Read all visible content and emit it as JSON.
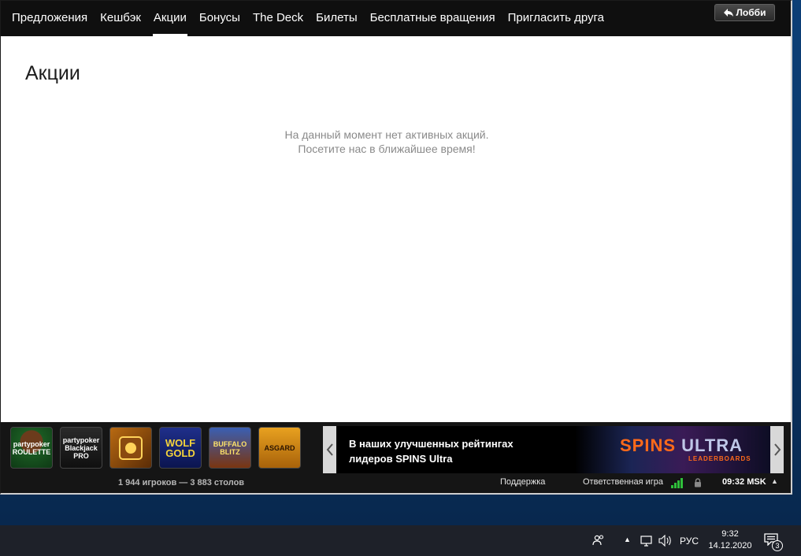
{
  "nav": {
    "tabs": [
      {
        "label": "Предложения"
      },
      {
        "label": "Кешбэк"
      },
      {
        "label": "Акции"
      },
      {
        "label": "Бонусы"
      },
      {
        "label": "The Deck"
      },
      {
        "label": "Билеты"
      },
      {
        "label": "Бесплатные вращения"
      },
      {
        "label": "Пригласить друга"
      }
    ],
    "active_tab": "Акции",
    "lobby_label": "Лобби"
  },
  "main": {
    "title": "Акции",
    "empty_line1": "На данный момент нет активных акций.",
    "empty_line2": "Посетите нас в ближайшее время!"
  },
  "games": [
    {
      "brand": "partypoker",
      "name": "ROULETTE"
    },
    {
      "brand": "partypoker",
      "name": "Blackjack PRO"
    },
    {
      "brand": "",
      "name": ""
    },
    {
      "brand": "WOLF",
      "name": "GOLD"
    },
    {
      "brand": "BUFFALO",
      "name": "BLITZ"
    },
    {
      "brand": "",
      "name": "ASGARD"
    }
  ],
  "stats": {
    "players": "1 944 игроков",
    "separator": "—",
    "tables": "3 883 столов"
  },
  "banner": {
    "line1": "В наших улучшенных рейтингах",
    "line2": "лидеров SPINS Ultra",
    "logo_spins": "SPINS",
    "logo_ultra": "ULTRA",
    "logo_sub": "LEADERBOARDS"
  },
  "status": {
    "support": "Поддержка",
    "responsible": "Ответственная игра",
    "clock": "09:32 MSK"
  },
  "taskbar": {
    "lang": "РУС",
    "time": "9:32",
    "date": "14.12.2020",
    "notifications": "3"
  },
  "colors": {
    "nav_bg": "#0f0f0f",
    "bottombar_bg": "#151515",
    "signal": "#2fbf3a",
    "banner_accent": "#ff6a1a"
  }
}
